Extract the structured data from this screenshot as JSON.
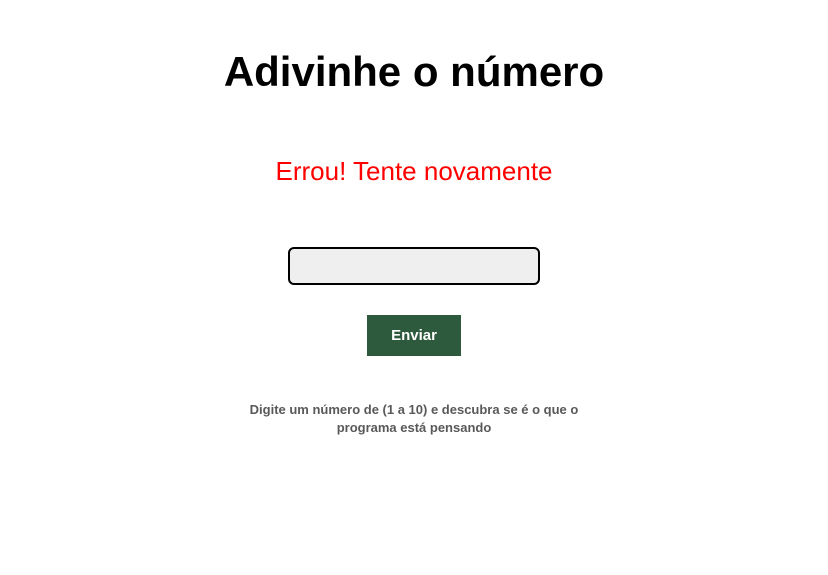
{
  "header": {
    "title": "Adivinhe o número"
  },
  "feedback": {
    "error_message": "Errou! Tente novamente"
  },
  "form": {
    "input_value": "",
    "input_placeholder": "",
    "submit_label": "Enviar"
  },
  "instruction": {
    "text": "Digite um número de (1 a 10) e descubra se é o que o programa está pensando"
  }
}
